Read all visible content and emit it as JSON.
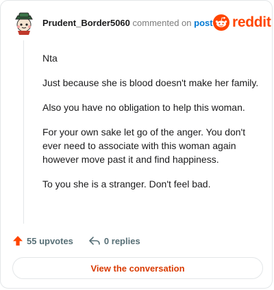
{
  "comment": {
    "username": "Prudent_Border5060",
    "action_text": "commented on",
    "post_link": "post",
    "brand": "reddit",
    "avatar": "snoo-avatar-icon",
    "paragraphs": [
      "Nta",
      "Just because she is blood doesn't make her family.",
      "Also you have no obligation to help this woman.",
      "For your own sake let go of the anger. You don't ever need to associate with this woman again however move past it and find happiness.",
      "To you she is a stranger. Don't feel bad."
    ]
  },
  "footer": {
    "upvotes": "55 upvotes",
    "replies": "0 replies",
    "cta": "View the conversation"
  },
  "colors": {
    "accent": "#ff4500",
    "link": "#0079d3",
    "cta_text": "#d93a00"
  }
}
